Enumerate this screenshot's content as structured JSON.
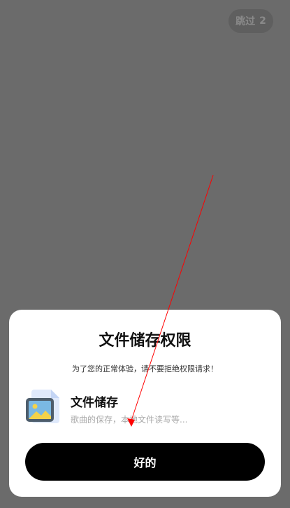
{
  "skip_button": {
    "label": "跳过",
    "countdown": "2"
  },
  "dialog": {
    "title": "文件储存权限",
    "subtitle": "为了您的正常体验，请不要拒绝权限请求！",
    "permission": {
      "name": "文件储存",
      "description": "歌曲的保存，本地文件读写等...",
      "icon": "file-image-icon"
    },
    "confirm_label": "好的"
  },
  "colors": {
    "backdrop": "#6b6b6b",
    "button": "#000000",
    "annotation_arrow": "#ff0000"
  }
}
